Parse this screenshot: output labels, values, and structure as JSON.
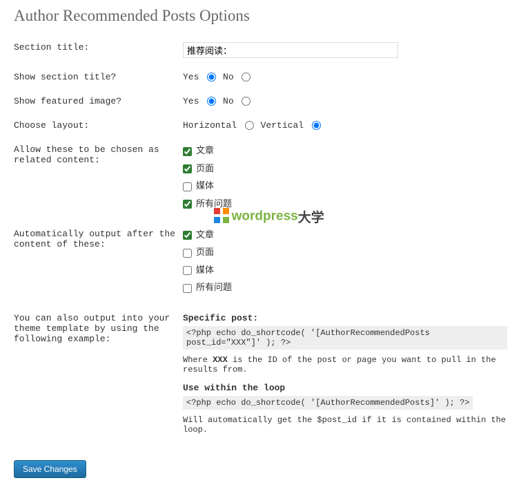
{
  "page_title": "Author Recommended Posts Options",
  "rows": {
    "section_title": {
      "label": "Section title:",
      "value": "推荐阅读："
    },
    "show_section_title": {
      "label": "Show section title?",
      "yes": "Yes",
      "no": "No"
    },
    "show_featured_image": {
      "label": "Show featured image?",
      "yes": "Yes",
      "no": "No"
    },
    "choose_layout": {
      "label": "Choose layout:",
      "horizontal": "Horizontal",
      "vertical": "Vertical"
    },
    "allow_related": {
      "label": "Allow these to be chosen as related content:",
      "opt1": "文章",
      "opt2": "页面",
      "opt3": "媒体",
      "opt4": "所有问题"
    },
    "auto_output": {
      "label": "Automatically output after the content of these:",
      "opt1": "文章",
      "opt2": "页面",
      "opt3": "媒体",
      "opt4": "所有问题"
    },
    "template_output": {
      "label": "You can also output into your theme template by using the following example:",
      "specific_heading": "Specific post:",
      "specific_code": "<?php echo do_shortcode( '[AuthorRecommendedPosts post_id=\"XXX\"]' ); ?>",
      "specific_desc_pre": "Where ",
      "specific_desc_bold": "XXX",
      "specific_desc_post": " is the ID of the post or page you want to pull in the results from.",
      "loop_heading": "Use within the loop",
      "loop_code": "<?php echo do_shortcode( '[AuthorRecommendedPosts]' ); ?>",
      "loop_desc": "Will automatically get the $post_id if it is contained within the loop."
    }
  },
  "save_button": "Save Changes",
  "watermark": {
    "brand": "wordpress",
    "suffix": "大学"
  }
}
